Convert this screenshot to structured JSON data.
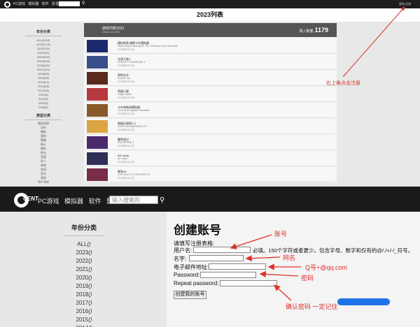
{
  "top": {
    "nav_links": [
      "PC游戏",
      "模拟器",
      "软件",
      "影视"
    ],
    "account_link": "登陆/注册",
    "page_title": "2023列表",
    "sidebar": {
      "heading": "年份分类",
      "years": [
        "ALL(3229)",
        "2023(1179)",
        "2022(720)",
        "2021(80)",
        "2020(409)",
        "2019(209)",
        "2018(249)",
        "2017(114)",
        "2016(69)",
        "2015(28)",
        "2014(42)",
        "2013(28)",
        "2012(18)",
        "2011(8)",
        "2010(3)",
        "2009(3)",
        "2008(2)"
      ],
      "type_heading": "类型分类",
      "types": [
        "角色扮演",
        "动作",
        "模拟",
        "冒险",
        "策略",
        "格斗",
        "模拟",
        "射击",
        "竞速",
        "多人",
        "体育",
        "休闲",
        "音乐",
        "其他",
        "国产游戏"
      ]
    },
    "list_header": {
      "title": "游戏列表2023",
      "subtitle": "Game List 2023",
      "count_label": "录入数量",
      "count": "1179"
    },
    "rows": [
      {
        "title": "模拟收获:越野卡车模拟器",
        "subtitle": "Heavy Duty Challenge®: The Off-Road Truck Simulator",
        "date": "2023年8月19日",
        "color": "#1b2a6b"
      },
      {
        "title": "无双大蛇4",
        "subtitle": "DYNASTY WARRIORS 4",
        "date": "2023年8月19日",
        "color": "#3a4e8c"
      },
      {
        "title": "鸦鸣文字",
        "subtitle": "Raven's Ink",
        "date": "2023年8月19日",
        "color": "#5a2a1e"
      },
      {
        "title": "鸡蛋小屋",
        "subtitle": "Sugar Waste",
        "date": "2023年8月19日",
        "color": "#b8393d"
      },
      {
        "title": "卡车和物流模拟器",
        "subtitle": "Truck and Logistics Simulator",
        "date": "2023年8月19日",
        "color": "#8a5a2a"
      },
      {
        "title": "超级玛丽佩人2",
        "subtitle": "SUPER BOMBERMAN R 2",
        "date": "2023年8月19日",
        "color": "#d9a441"
      },
      {
        "title": "魔界战记",
        "subtitle": "DUNGEONS 4",
        "date": "2023年8月19日",
        "color": "#4b2b6e"
      },
      {
        "title": "AK-xolotl",
        "subtitle": "AK-xolotl",
        "date": "2023年8月19日",
        "color": "#2f2f58"
      },
      {
        "title": "拳皇15",
        "subtitle": "THE KING OF FIGHTERS XV",
        "date": "2023年8月19日",
        "color": "#7a2d4a"
      }
    ],
    "annotation": "右上角点击注册"
  },
  "bottom": {
    "nav_links": [
      "PC游戏",
      "模拟器",
      "软件",
      "影视"
    ],
    "search_placeholder": "输入搜索的",
    "logo_text": "CENT",
    "sidebar": {
      "heading": "年份分类",
      "years": [
        "ALL",
        "2023",
        "2022",
        "2021",
        "2020",
        "2019",
        "2018",
        "2017",
        "2016",
        "2015",
        "2014"
      ],
      "year_suffix": "()"
    },
    "form": {
      "heading": "创建账号",
      "intro": "请填写注册表格:",
      "username_label": "用户名:",
      "username_hint": "必填。150个字符或者更少。包含字母、数字和仅有的@/./+/-/_符号。",
      "name_label": "名字:",
      "email_label": "电子邮件地址:",
      "password_label": "Password:",
      "repeat_label": "Repeat password:",
      "submit_label": "创建我的账号"
    },
    "annotations": {
      "account": "账号",
      "name": "网名",
      "email": "Q号+@qq.com",
      "password": "密码",
      "remember": "确认密码 一定记住"
    }
  },
  "colors": {
    "accent_red": "#e0302a",
    "nav_dark": "#1a1a1a",
    "scribble_blue": "#1e73e8"
  }
}
